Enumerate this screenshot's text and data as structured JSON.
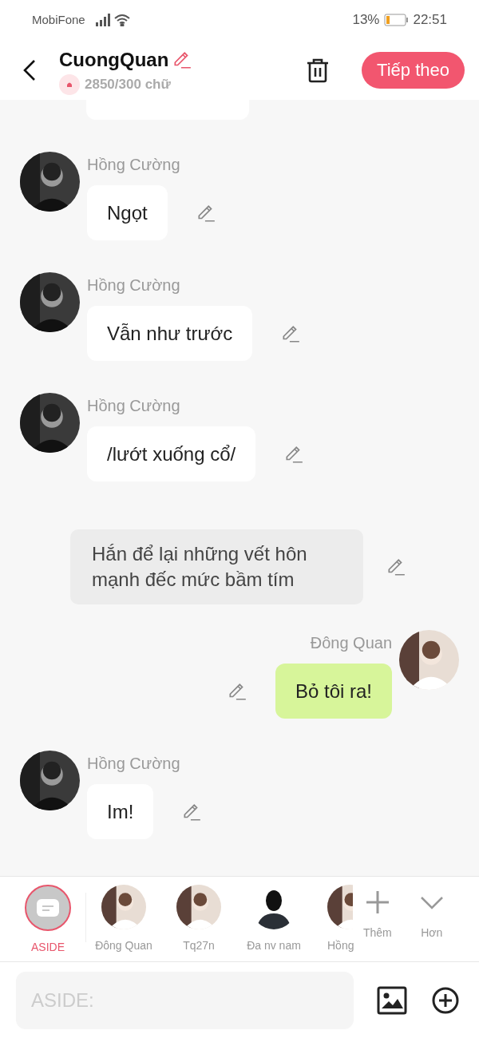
{
  "status_bar": {
    "carrier": "MobiFone",
    "battery": "13%",
    "time": "22:51"
  },
  "header": {
    "title": "CuongQuan",
    "count": "2850/300 chữ",
    "next_button": "Tiếp theo"
  },
  "messages": [
    {
      "kind": "left",
      "sender": "Hồng Cường",
      "text": "Ngọt"
    },
    {
      "kind": "left",
      "sender": "Hồng Cường",
      "text": "Vẫn như trước"
    },
    {
      "kind": "left",
      "sender": "Hồng Cường",
      "text": "/lướt xuống cổ/"
    },
    {
      "kind": "aside",
      "text": "Hắn để lại những vết hôn mạnh đếc mức bầm tím"
    },
    {
      "kind": "right",
      "sender": "Đông Quan",
      "text": "Bỏ tôi ra!"
    },
    {
      "kind": "left",
      "sender": "Hồng Cường",
      "text": "Im!"
    }
  ],
  "characters": [
    {
      "kind": "aside",
      "label": "ASIDE",
      "selected": true
    },
    {
      "label": "Đông Quan",
      "selected": false
    },
    {
      "label": "Tq27n",
      "selected": false
    },
    {
      "kind": "silhouette",
      "label": "Đa nv nam",
      "selected": false
    },
    {
      "label": "Hồng",
      "selected": false
    }
  ],
  "add_label": "Thêm",
  "more_label": "Hơn",
  "input": {
    "placeholder": "ASIDE:"
  }
}
